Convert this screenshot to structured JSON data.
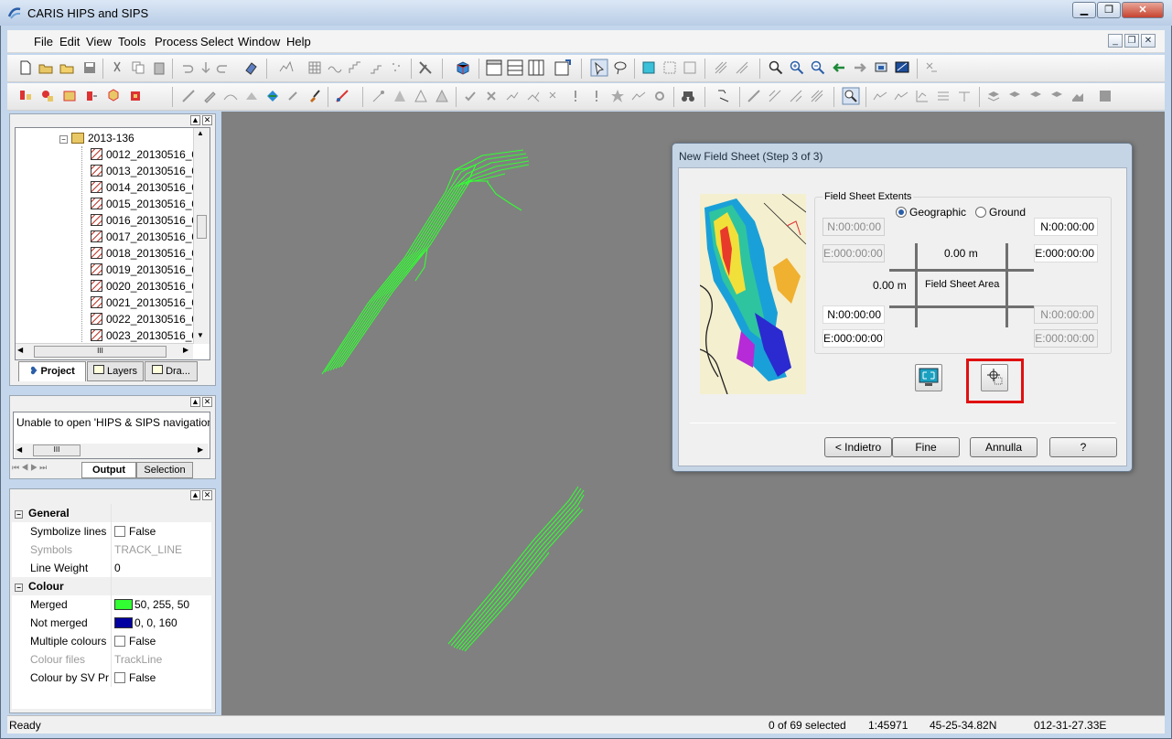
{
  "app": {
    "title": "CARIS HIPS and SIPS"
  },
  "menu": [
    "File",
    "Edit",
    "View",
    "Tools",
    "Process",
    "Select",
    "Window",
    "Help"
  ],
  "project_tree": {
    "folder": "2013-136",
    "lines": [
      "0012_20130516_0",
      "0013_20130516_0",
      "0014_20130516_0",
      "0015_20130516_0",
      "0016_20130516_0",
      "0017_20130516_0",
      "0018_20130516_0",
      "0019_20130516_0",
      "0020_20130516_0",
      "0021_20130516_0",
      "0022_20130516_0",
      "0023_20130516_0"
    ]
  },
  "left_tabs": {
    "project": "Project",
    "layers": "Layers",
    "draw": "Dra..."
  },
  "output": {
    "message": "Unable to open 'HIPS & SIPS navigation",
    "tab_output": "Output",
    "tab_selection": "Selection"
  },
  "properties": {
    "general_header": "General",
    "colour_header": "Colour",
    "rows": {
      "symbolize_lines": {
        "label": "Symbolize lines",
        "value": "False"
      },
      "symbols": {
        "label": "Symbols",
        "value": "TRACK_LINE"
      },
      "line_weight": {
        "label": "Line Weight",
        "value": "0"
      },
      "merged": {
        "label": "Merged",
        "value": "50, 255, 50",
        "color": "#32ff32"
      },
      "not_merged": {
        "label": "Not merged",
        "value": "0, 0, 160",
        "color": "#0000a0"
      },
      "multiple_colours": {
        "label": "Multiple colours",
        "value": "False"
      },
      "colour_files": {
        "label": "Colour files",
        "value": "TrackLine"
      },
      "colour_by_sv": {
        "label": "Colour by SV Pr",
        "value": "False"
      }
    }
  },
  "dialog": {
    "title": "New Field Sheet (Step 3 of 3)",
    "group_label": "Field Sheet Extents",
    "radio_geographic": "Geographic",
    "radio_ground": "Ground",
    "top_left_n": "N:00:00:00",
    "top_left_e": "E:000:00:00",
    "top_right_n": "N:00:00:00",
    "top_right_e": "E:000:00:00",
    "bottom_left_n": "N:00:00:00",
    "bottom_left_e": "E:000:00:00",
    "bottom_right_n": "N:00:00:00",
    "bottom_right_e": "E:000:00:00",
    "width_value": "0.00 m",
    "height_value": "0.00 m",
    "area_label": "Field Sheet Area",
    "buttons": {
      "back": "< Indietro",
      "finish": "Fine",
      "cancel": "Annulla",
      "help": "?"
    },
    "highlight_color": "#e01010"
  },
  "status": {
    "ready": "Ready",
    "selected": "0 of 69 selected",
    "scale": "1:45971",
    "lat": "45-25-34.82N",
    "lon": "012-31-27.33E"
  },
  "colors": {
    "track": "#32ff32",
    "map_bg": "#808080"
  }
}
